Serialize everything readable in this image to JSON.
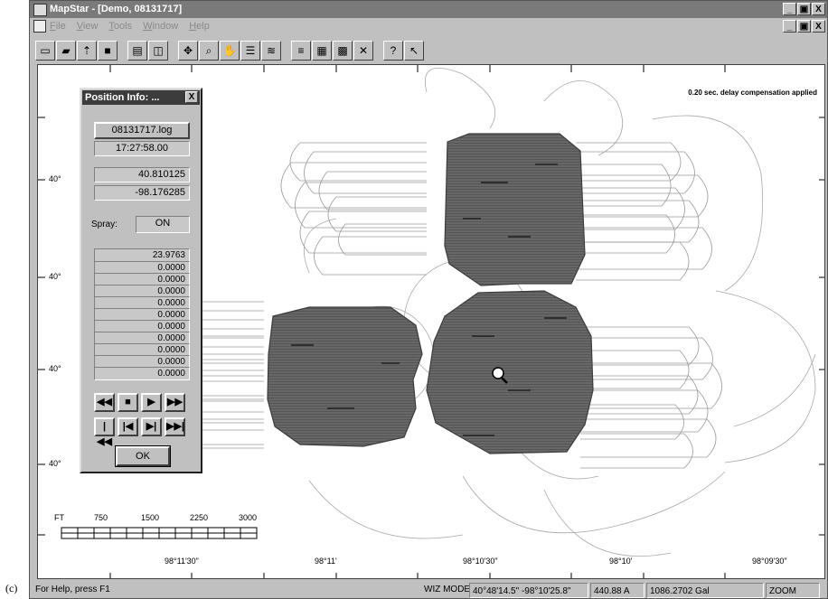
{
  "caption": "(c)",
  "window": {
    "title": "MapStar - [Demo, 08131717]",
    "minimize": "_",
    "maximize": "▣",
    "close": "X"
  },
  "menu": [
    "File",
    "View",
    "Tools",
    "Window",
    "Help"
  ],
  "toolbar_icons": [
    "new-icon",
    "open-icon",
    "upload-log-icon",
    "save-icon",
    "print-icon",
    "print-preview-icon",
    "pan-icon",
    "zoom-icon",
    "hand-icon",
    "grid-icon",
    "layers-icon",
    "list-icon",
    "log-icon",
    "sys-icon",
    "tools-icon",
    "help-icon",
    "context-help-icon"
  ],
  "map": {
    "note": "0.20 sec. delay compensation applied",
    "lat_labels": [
      "40°",
      "40°",
      "40°",
      "40°",
      "40°"
    ],
    "lon_labels": [
      "98°11'30\"",
      "98°11'",
      "98°10'30\"",
      "98°10'",
      "98°09'30\""
    ],
    "scale": {
      "unit": "FT",
      "ticks": [
        "750",
        "1500",
        "2250",
        "3000"
      ]
    }
  },
  "position_info": {
    "title": "Position Info: ...",
    "close": "X",
    "log": "08131717.log",
    "time": "17:27:58.00",
    "lat": "40.810125",
    "lon": "-98.176285",
    "spray_label": "Spray:",
    "spray_value": "ON",
    "values": [
      "23.9763",
      "0.0000",
      "0.0000",
      "0.0000",
      "0.0000",
      "0.0000",
      "0.0000",
      "0.0000",
      "0.0000",
      "0.0000",
      "0.0000"
    ],
    "ok": "OK"
  },
  "status": {
    "help": "For Help, press F1",
    "mode": "WIZ MODE",
    "coords": "40°48'14.5\" -98°10'25.8\"",
    "amps": "440.88 A",
    "volume": "1086.2702 Gal",
    "zoom": "ZOOM"
  }
}
